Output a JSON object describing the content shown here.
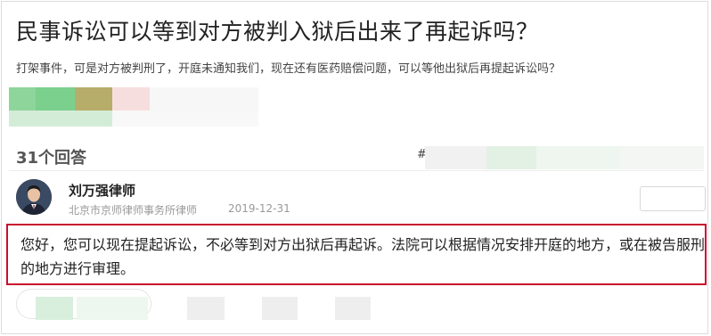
{
  "question": {
    "title": "民事诉讼可以等到对方被判入狱后出来了再起诉吗？",
    "description": "打架事件，可是对方被判刑了，开庭未通知我们，现在还有医药赔偿问题，可以等他出狱后再提起诉讼吗？"
  },
  "answers": {
    "count_label": "31个回答",
    "hash_mark": "#"
  },
  "answer": {
    "lawyer_name": "刘万强律师",
    "law_firm": "北京市京师律师事务所律师",
    "date": "2019-12-31",
    "content": "您好，您可以现在提起诉讼，不必等到对方出狱后再起诉。法院可以根据情况安排开庭的地方，或在被告服刑的地方进行审理。"
  },
  "colors": {
    "highlight_border": "#c8102e",
    "title_text": "#222222",
    "muted_text": "#999999"
  }
}
